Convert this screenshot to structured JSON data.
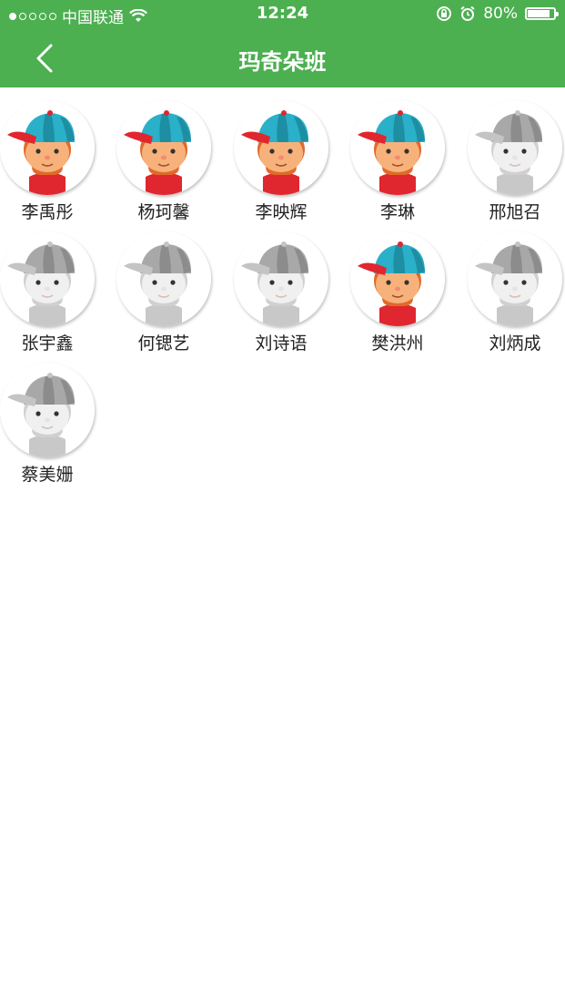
{
  "status_bar": {
    "carrier": "中国联通",
    "time": "12:24",
    "battery": "80%"
  },
  "nav": {
    "title": "玛奇朵班"
  },
  "students": [
    {
      "name": "李禹彤",
      "active": true
    },
    {
      "name": "杨珂馨",
      "active": true
    },
    {
      "name": "李映辉",
      "active": true
    },
    {
      "name": "李琳",
      "active": true
    },
    {
      "name": "邢旭召",
      "active": false
    },
    {
      "name": "张宇鑫",
      "active": false
    },
    {
      "name": "何锶艺",
      "active": false
    },
    {
      "name": "刘诗语",
      "active": false
    },
    {
      "name": "樊洪州",
      "active": true
    },
    {
      "name": "刘炳成",
      "active": false
    },
    {
      "name": "蔡美姗",
      "active": false
    }
  ],
  "colors": {
    "header": "#4caf50",
    "cap_blue": "#2ab0c8",
    "cap_red": "#e0262e",
    "skin": "#f7b27c",
    "hair": "#e06a2a",
    "gray_cap": "#a8a8a8",
    "gray_skin": "#f0f0f0"
  }
}
